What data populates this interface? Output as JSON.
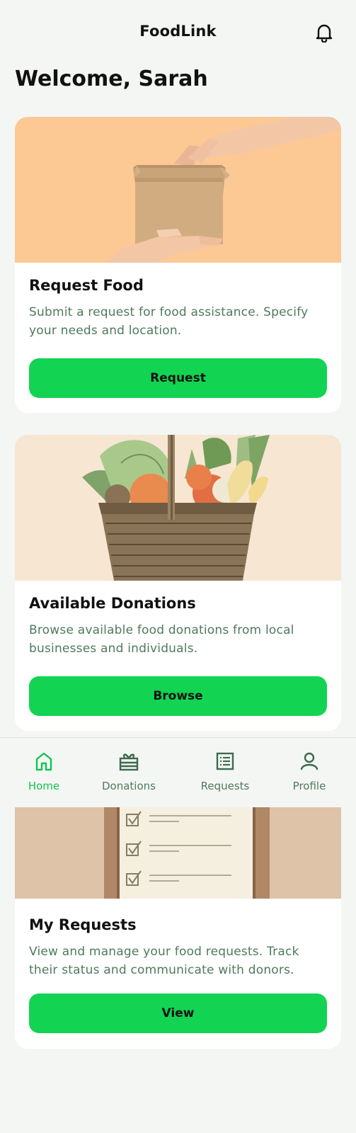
{
  "header": {
    "title": "FoodLink",
    "notification_icon": "bell-icon"
  },
  "welcome": "Welcome, Sarah",
  "cards": [
    {
      "title": "Request Food",
      "description": "Submit a request for food assistance. Specify your needs and location.",
      "button": "Request",
      "image": "hands-holding-cardboard-box"
    },
    {
      "title": "Available Donations",
      "description": "Browse available food donations from local businesses and individuals.",
      "button": "Browse",
      "image": "basket-of-vegetables"
    },
    {
      "title": "My Requests",
      "description": "View and manage your food requests. Track their status and communicate with donors.",
      "button": "View",
      "image": "checklist-notepad"
    }
  ],
  "bottom_nav": {
    "items": [
      {
        "label": "Home",
        "icon": "home-icon",
        "active": true
      },
      {
        "label": "Donations",
        "icon": "gift-icon",
        "active": false
      },
      {
        "label": "Requests",
        "icon": "list-icon",
        "active": false
      },
      {
        "label": "Profile",
        "icon": "user-icon",
        "active": false
      }
    ]
  },
  "colors": {
    "accent": "#12d452",
    "active_nav": "#12c44e",
    "muted_text": "#4e7a5d",
    "background": "#f4f6f4"
  }
}
